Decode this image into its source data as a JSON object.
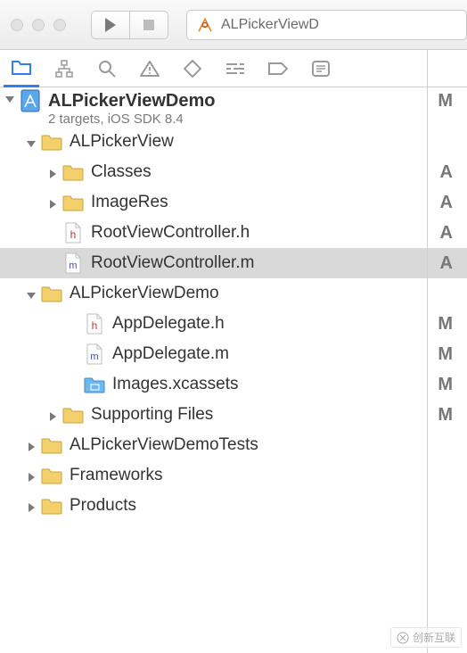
{
  "toolbar": {
    "scheme_title": "ALPickerViewD"
  },
  "project": {
    "name": "ALPickerViewDemo",
    "subtitle": "2 targets, iOS SDK 8.4",
    "status": "M"
  },
  "tree": [
    {
      "indent": 1,
      "disclosure": "down",
      "icon": "folder",
      "label": "ALPickerView",
      "status": ""
    },
    {
      "indent": 2,
      "disclosure": "right",
      "icon": "folder",
      "label": "Classes",
      "status": "A"
    },
    {
      "indent": 2,
      "disclosure": "right",
      "icon": "folder",
      "label": "ImageRes",
      "status": "A"
    },
    {
      "indent": 2,
      "disclosure": "none",
      "icon": "h",
      "label": "RootViewController.h",
      "status": "A"
    },
    {
      "indent": 2,
      "disclosure": "none",
      "icon": "m",
      "label": "RootViewController.m",
      "status": "A",
      "selected": true
    },
    {
      "indent": 1,
      "disclosure": "down",
      "icon": "folder",
      "label": "ALPickerViewDemo",
      "status": ""
    },
    {
      "indent": 3,
      "disclosure": "none",
      "icon": "h",
      "label": "AppDelegate.h",
      "status": "M"
    },
    {
      "indent": 3,
      "disclosure": "none",
      "icon": "m",
      "label": "AppDelegate.m",
      "status": "M"
    },
    {
      "indent": 3,
      "disclosure": "none",
      "icon": "assets",
      "label": "Images.xcassets",
      "status": "M"
    },
    {
      "indent": 2,
      "disclosure": "right",
      "icon": "folder",
      "label": "Supporting Files",
      "status": "M"
    },
    {
      "indent": 1,
      "disclosure": "right",
      "icon": "folder",
      "label": "ALPickerViewDemoTests",
      "status": ""
    },
    {
      "indent": 1,
      "disclosure": "right",
      "icon": "folder",
      "label": "Frameworks",
      "status": ""
    },
    {
      "indent": 1,
      "disclosure": "right",
      "icon": "folder",
      "label": "Products",
      "status": ""
    }
  ],
  "watermark": "创新互联"
}
